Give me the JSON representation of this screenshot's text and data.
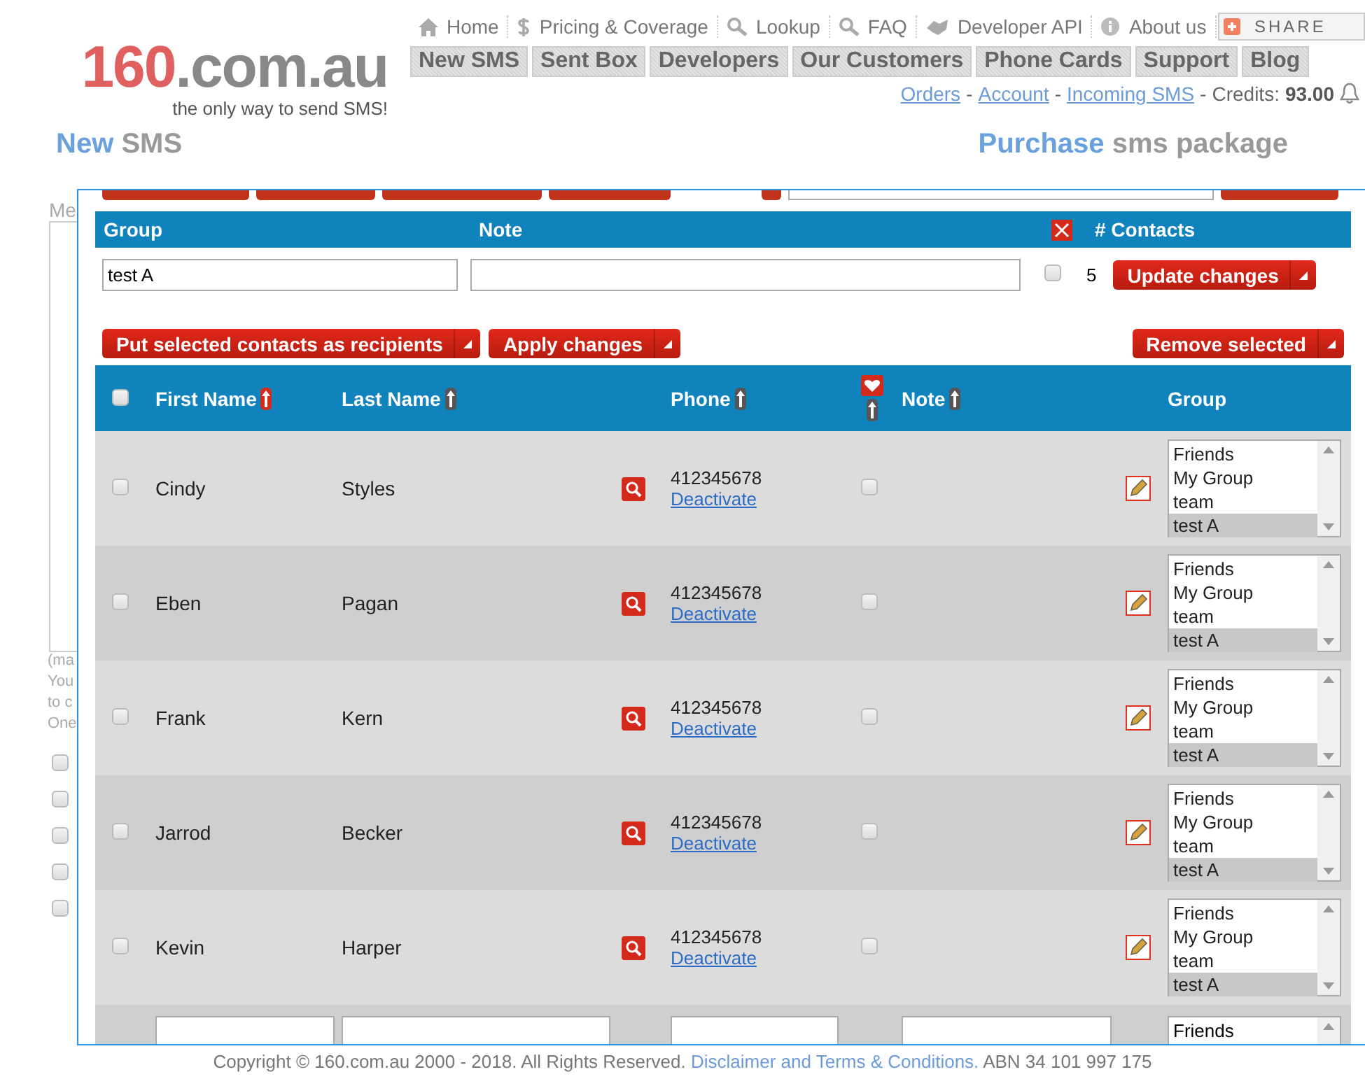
{
  "header": {
    "logo": {
      "brand": "160",
      "domain": ".com.au"
    },
    "tagline": "the only way to send SMS!",
    "top_links": [
      {
        "label": "Home"
      },
      {
        "label": "Pricing & Coverage"
      },
      {
        "label": "Lookup"
      },
      {
        "label": "FAQ"
      },
      {
        "label": "Developer API"
      },
      {
        "label": "About us"
      }
    ],
    "share_button": "SHARE",
    "nav_tabs": [
      {
        "label": "New SMS"
      },
      {
        "label": "Sent Box"
      },
      {
        "label": "Developers"
      },
      {
        "label": "Our Customers"
      },
      {
        "label": "Phone Cards"
      },
      {
        "label": "Support"
      },
      {
        "label": "Blog"
      }
    ],
    "account_links": [
      {
        "kind": "link",
        "label": "Orders"
      },
      {
        "kind": "separator",
        "label": "-"
      },
      {
        "kind": "link",
        "label": "Account"
      },
      {
        "kind": "separator",
        "label": "-"
      },
      {
        "kind": "link",
        "label": "Incoming SMS"
      },
      {
        "kind": "separator",
        "label": "-"
      }
    ],
    "credits": {
      "label": "Credits:",
      "value": "93.00"
    }
  },
  "titles": [
    {
      "first": "New",
      "second": "SMS"
    },
    {
      "first": "Purchase",
      "second": "sms package"
    }
  ],
  "background_form": {
    "label": "Me",
    "notes": [
      "(ma",
      "You",
      "to c",
      "One"
    ],
    "checkboxes": [
      {
        "checked": false
      },
      {
        "checked": false
      },
      {
        "checked": false
      },
      {
        "checked": false
      },
      {
        "checked": false
      }
    ]
  },
  "dialog": {
    "group_table": {
      "columns": [
        "Group",
        "Note",
        "# Contacts"
      ],
      "group_name": "test A",
      "delete_checked": false,
      "contacts": "5",
      "button": "Update changes"
    },
    "actions_left": [
      {
        "label": "Put selected contacts as recipients"
      },
      {
        "label": "Apply changes"
      }
    ],
    "actions_right": [
      {
        "label": "Remove selected"
      }
    ],
    "contacts_table": {
      "select_all_checked": false,
      "columns": [
        {
          "label": "First Name",
          "sorted": true
        },
        {
          "label": "Last Name",
          "sorted": false
        },
        {
          "label": "Phone",
          "sorted": false
        },
        {
          "label": "Note",
          "sorted": false
        },
        {
          "label": "Group"
        }
      ],
      "favourite_column": {
        "sorted": false
      },
      "rows": [
        {
          "kind": "contact",
          "checked": false,
          "first_name": "Cindy",
          "last_name": "Styles",
          "phone": "412345678",
          "link": "Deactivate",
          "favourite": false,
          "groups": [
            {
              "label": "Friends",
              "selected": false
            },
            {
              "label": "My Group",
              "selected": false
            },
            {
              "label": "team",
              "selected": false
            },
            {
              "label": "test A",
              "selected": true
            }
          ]
        },
        {
          "kind": "contact",
          "checked": false,
          "first_name": "Eben",
          "last_name": "Pagan",
          "phone": "412345678",
          "link": "Deactivate",
          "favourite": false,
          "groups": [
            {
              "label": "Friends",
              "selected": false
            },
            {
              "label": "My Group",
              "selected": false
            },
            {
              "label": "team",
              "selected": false
            },
            {
              "label": "test A",
              "selected": true
            }
          ]
        },
        {
          "kind": "contact",
          "checked": false,
          "first_name": "Frank",
          "last_name": "Kern",
          "phone": "412345678",
          "link": "Deactivate",
          "favourite": false,
          "groups": [
            {
              "label": "Friends",
              "selected": false
            },
            {
              "label": "My Group",
              "selected": false
            },
            {
              "label": "team",
              "selected": false
            },
            {
              "label": "test A",
              "selected": true
            }
          ]
        },
        {
          "kind": "contact",
          "checked": false,
          "first_name": "Jarrod",
          "last_name": "Becker",
          "phone": "412345678",
          "link": "Deactivate",
          "favourite": false,
          "groups": [
            {
              "label": "Friends",
              "selected": false
            },
            {
              "label": "My Group",
              "selected": false
            },
            {
              "label": "team",
              "selected": false
            },
            {
              "label": "test A",
              "selected": true
            }
          ]
        },
        {
          "kind": "contact",
          "checked": false,
          "first_name": "Kevin",
          "last_name": "Harper",
          "phone": "412345678",
          "link": "Deactivate",
          "favourite": false,
          "groups": [
            {
              "label": "Friends",
              "selected": false
            },
            {
              "label": "My Group",
              "selected": false
            },
            {
              "label": "team",
              "selected": false
            },
            {
              "label": "test A",
              "selected": true
            }
          ]
        },
        {
          "kind": "new",
          "groups": [
            {
              "label": "Friends",
              "selected": false
            }
          ]
        }
      ]
    }
  },
  "footer": {
    "copyright": "Copyright © 160.com.au 2000 - 2018. All Rights Reserved.",
    "link": "Disclaimer and Terms & Conditions.",
    "abn": "ABN 34 101 997 175"
  }
}
